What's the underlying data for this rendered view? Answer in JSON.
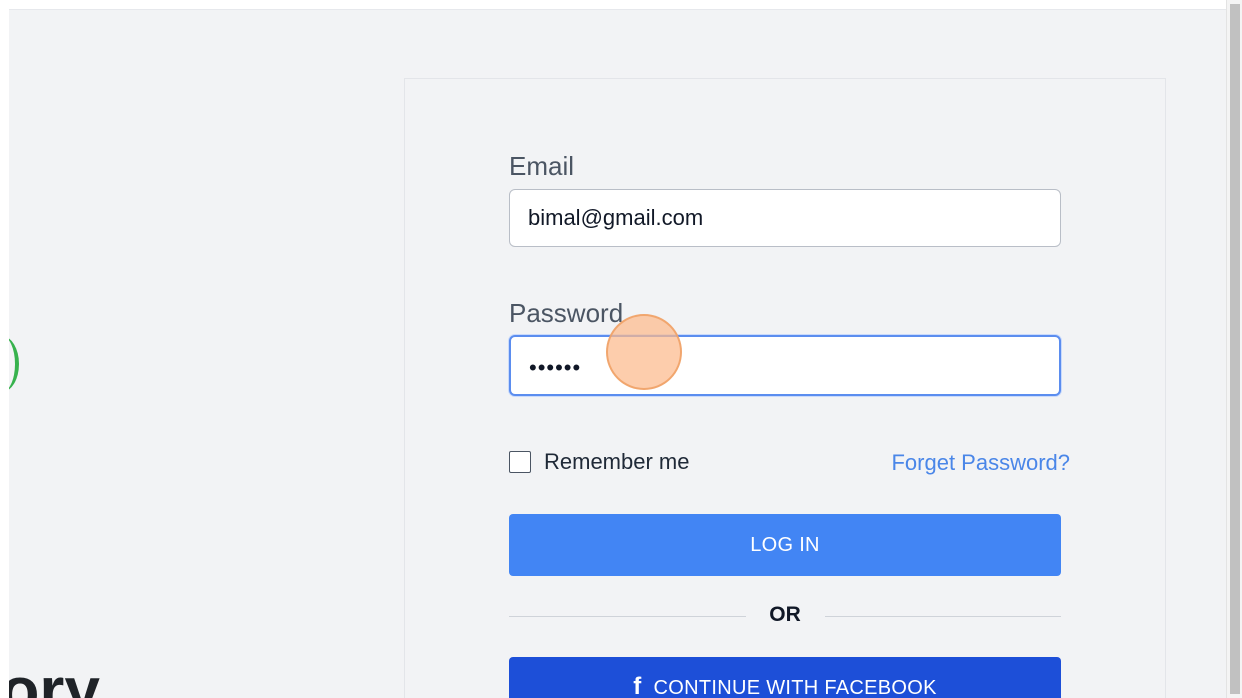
{
  "hero": {
    "heading_fragment": "tory"
  },
  "login_form": {
    "email": {
      "label": "Email",
      "value": "bimal@gmail.com"
    },
    "password": {
      "label": "Password",
      "masked_value": "••••••"
    },
    "remember_me": {
      "label": "Remember me",
      "checked": false
    },
    "forgot_password_link": "Forget Password?",
    "login_button": "LOG IN",
    "divider_text": "OR",
    "facebook_button": {
      "icon": "facebook-icon",
      "label": "CONTINUE WITH FACEBOOK"
    }
  },
  "colors": {
    "page_background": "#f2f3f5",
    "login_button": "#4285f4",
    "facebook_button": "#1d4fd8",
    "link": "#4a86e8",
    "focus_border": "#5b8def",
    "hero_accent": "#37b24d",
    "click_marker": "#fcba8c"
  }
}
